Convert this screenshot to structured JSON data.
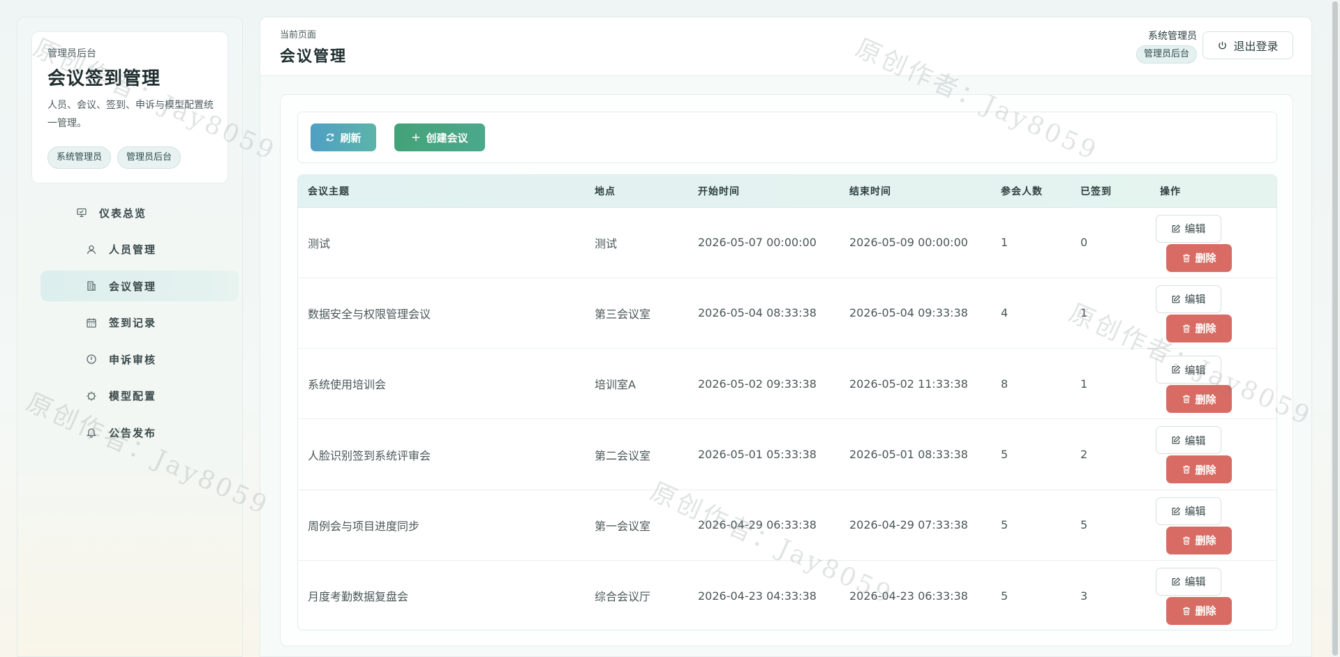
{
  "sidebar": {
    "kicker": "管理员后台",
    "title": "会议签到管理",
    "description": "人员、会议、签到、申诉与模型配置统一管理。",
    "tags": [
      "系统管理员",
      "管理员后台"
    ],
    "nav": [
      {
        "label": "仪表总览",
        "icon": "presentation-icon",
        "active": false
      },
      {
        "label": "人员管理",
        "icon": "user-icon",
        "active": false
      },
      {
        "label": "会议管理",
        "icon": "building-icon",
        "active": true
      },
      {
        "label": "签到记录",
        "icon": "calendar-icon",
        "active": false
      },
      {
        "label": "申诉审核",
        "icon": "alert-circle-icon",
        "active": false
      },
      {
        "label": "模型配置",
        "icon": "cpu-icon",
        "active": false
      },
      {
        "label": "公告发布",
        "icon": "bell-icon",
        "active": false
      }
    ]
  },
  "header": {
    "crumb": "当前页面",
    "title": "会议管理",
    "user_name": "系统管理员",
    "user_role": "管理员后台",
    "logout_label": "退出登录"
  },
  "toolbar": {
    "refresh_label": "刷新",
    "create_label": "创建会议"
  },
  "table": {
    "columns": [
      "会议主题",
      "地点",
      "开始时间",
      "结束时间",
      "参会人数",
      "已签到",
      "操作"
    ],
    "edit_label": "编辑",
    "delete_label": "删除",
    "rows": [
      {
        "topic": "测试",
        "location": "测试",
        "start": "2026-05-07 00:00:00",
        "end": "2026-05-09 00:00:00",
        "attendees": "1",
        "signed": "0"
      },
      {
        "topic": "数据安全与权限管理会议",
        "location": "第三会议室",
        "start": "2026-05-04 08:33:38",
        "end": "2026-05-04 09:33:38",
        "attendees": "4",
        "signed": "1"
      },
      {
        "topic": "系统使用培训会",
        "location": "培训室A",
        "start": "2026-05-02 09:33:38",
        "end": "2026-05-02 11:33:38",
        "attendees": "8",
        "signed": "1"
      },
      {
        "topic": "人脸识别签到系统评审会",
        "location": "第二会议室",
        "start": "2026-05-01 05:33:38",
        "end": "2026-05-01 08:33:38",
        "attendees": "5",
        "signed": "2"
      },
      {
        "topic": "周例会与项目进度同步",
        "location": "第一会议室",
        "start": "2026-04-29 06:33:38",
        "end": "2026-04-29 07:33:38",
        "attendees": "5",
        "signed": "5"
      },
      {
        "topic": "月度考勤数据复盘会",
        "location": "综合会议厅",
        "start": "2026-04-23 04:33:38",
        "end": "2026-04-23 06:33:38",
        "attendees": "5",
        "signed": "3"
      }
    ]
  },
  "watermark": "原创作者：Jay8059",
  "colors": {
    "accent_teal": "#5cb4a9",
    "create_green": "#44a279",
    "delete_red": "#d86b63"
  }
}
